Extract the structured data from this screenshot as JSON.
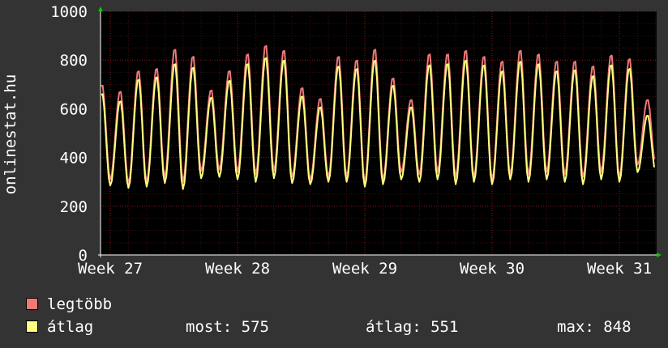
{
  "chart_data": {
    "type": "line",
    "ylabel": "onlinestat.hu",
    "ylim": [
      0,
      1000
    ],
    "yticks": [
      "0",
      "200",
      "400",
      "600",
      "800",
      "1000"
    ],
    "x_tick_labels": [
      "Week 27",
      "Week 28",
      "Week 29",
      "Week 30",
      "Week 31"
    ],
    "grid": true,
    "legend_position": "bottom",
    "days_per_week": 7,
    "series": [
      {
        "name": "legtöbb",
        "color": "#f07878",
        "daily_max": [
          795,
          700,
          675,
          760,
          770,
          850,
          820,
          680,
          760,
          830,
          865,
          845,
          690,
          645,
          820,
          805,
          850,
          730,
          640,
          830,
          830,
          845,
          820,
          800,
          845,
          830,
          800,
          800,
          780,
          825,
          810,
          640
        ],
        "daily_min": [
          370,
          350,
          310,
          295,
          300,
          320,
          300,
          345,
          350,
          340,
          330,
          345,
          320,
          310,
          320,
          320,
          300,
          310,
          340,
          330,
          340,
          320,
          320,
          310,
          330,
          330,
          340,
          330,
          320,
          340,
          320,
          370
        ]
      },
      {
        "name": "átlag",
        "color": "#ffff80",
        "daily_max": [
          760,
          665,
          635,
          725,
          735,
          790,
          775,
          650,
          720,
          790,
          815,
          805,
          655,
          610,
          780,
          770,
          805,
          700,
          610,
          785,
          790,
          805,
          785,
          760,
          800,
          790,
          760,
          765,
          740,
          785,
          770,
          575
        ],
        "daily_min": [
          340,
          320,
          285,
          275,
          280,
          295,
          270,
          315,
          320,
          310,
          300,
          315,
          295,
          290,
          300,
          300,
          280,
          290,
          310,
          300,
          310,
          290,
          300,
          290,
          310,
          300,
          310,
          300,
          290,
          310,
          300,
          340
        ]
      }
    ]
  },
  "legend": [
    {
      "label": "legtöbb",
      "color": "#f07878"
    },
    {
      "label": "átlag",
      "color": "#ffff80"
    }
  ],
  "stats": {
    "now": "most: 575",
    "avg": "átlag: 551",
    "max": "max: 848"
  },
  "colors": {
    "background": "#333333",
    "plot_background": "#000000",
    "grid": "#8b1a1a",
    "axis": "#ffffff",
    "arrow": "#00cc00"
  }
}
